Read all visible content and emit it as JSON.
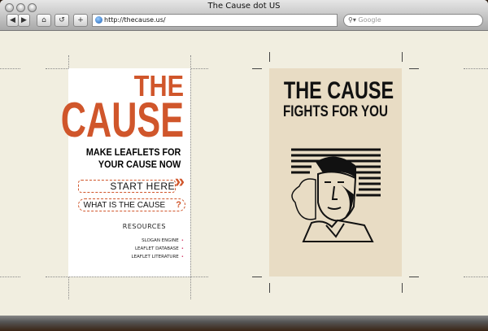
{
  "window": {
    "title": "The Cause dot US"
  },
  "toolbar": {
    "back": "◀",
    "forward": "▶",
    "home": "⌂",
    "reload": "↺",
    "add": "+",
    "url": "http://thecause.us/",
    "search_placeholder": "Google"
  },
  "leaflet": {
    "title_1": "THE",
    "title_2": "CAUSE",
    "tagline_1": "MAKE LEAFLETS FOR",
    "tagline_2": "YOUR CAUSE NOW",
    "start": "START HERE",
    "start_icon": "»",
    "what": "WHAT IS THE CAUSE",
    "what_icon": "?",
    "resources_heading": "RESOURCES",
    "resources": [
      "SLOGAN ENGINE",
      "LEAFLET DATABASE",
      "LEAFLET LITERATURE"
    ]
  },
  "poster": {
    "line_1": "THE CAUSE",
    "line_2": "FIGHTS FOR YOU"
  },
  "colors": {
    "accent": "#d0562b",
    "page_bg": "#f1eee0",
    "poster_bg": "#e8dcc4"
  }
}
